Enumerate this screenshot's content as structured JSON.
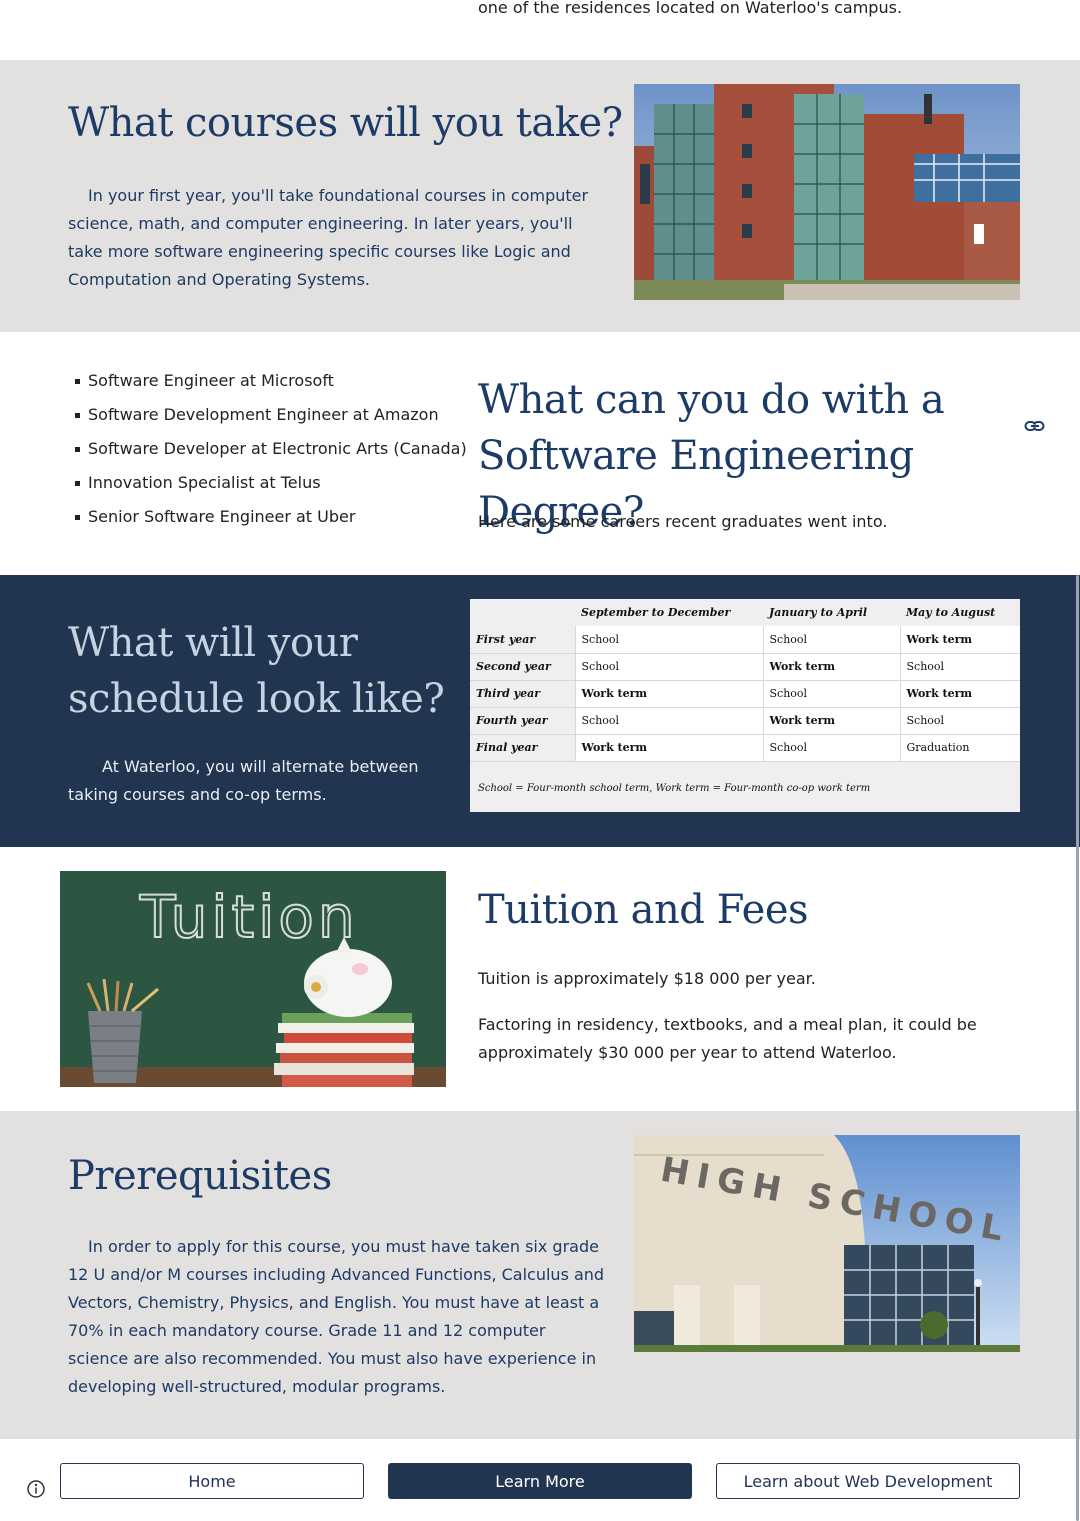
{
  "top": {
    "text": "one of the residences located on Waterloo's campus."
  },
  "courses": {
    "title": "What courses will you take?",
    "body": "In your first year, you'll take foundational courses in computer science, math, and computer engineering. In later years, you'll take more software engineering specific courses like Logic and Computation and Operating Systems."
  },
  "careers": {
    "items": [
      "Software Engineer at Microsoft",
      "Software Development Engineer at Amazon",
      "Software Developer at Electronic Arts (Canada)",
      "Innovation Specialist at Telus",
      "Senior Software Engineer at Uber"
    ],
    "title": "What can you do with a Software Engineering Degree?",
    "body": "Here are some careers recent graduates went into.",
    "link_icon": "link-icon"
  },
  "schedule": {
    "title": "What will your schedule look like?",
    "body": "At Waterloo, you will alternate between taking courses and co-op terms.",
    "table": {
      "headers": [
        "",
        "September to December",
        "January to April",
        "May to August"
      ],
      "rows": [
        [
          "First year",
          "School",
          "School",
          "Work term"
        ],
        [
          "Second year",
          "School",
          "Work term",
          "School"
        ],
        [
          "Third year",
          "Work term",
          "School",
          "Work term"
        ],
        [
          "Fourth year",
          "School",
          "Work term",
          "School"
        ],
        [
          "Final year",
          "Work term",
          "School",
          "Graduation"
        ]
      ],
      "legend": "School = Four-month school term, Work term = Four-month co-op work term"
    }
  },
  "tuition": {
    "title": "Tuition and Fees",
    "line1": "Tuition is approximately $18 000 per year.",
    "line2": "Factoring in residency, textbooks, and a meal plan, it could be approximately $30 000 per year to attend Waterloo.",
    "image_text": "Tuition"
  },
  "prereq": {
    "title": "Prerequisites",
    "body": "In order to apply for this course, you must have taken six grade 12 U and/or M courses including Advanced Functions, Calculus and Vectors, Chemistry, Physics, and English. You must have at least a 70% in each mandatory course. Grade 11 and 12 computer science are also recommended. You must also have experience in developing well-structured, modular programs.",
    "image_text": "HIGH SCHOOL"
  },
  "footer": {
    "home": "Home",
    "learn_more": "Learn More",
    "web_dev": "Learn about Web Development",
    "info_icon": "info-icon"
  },
  "colors": {
    "navy": "#213550",
    "heading_blue": "#1c3b66",
    "gray_bg": "#e2e1df"
  }
}
